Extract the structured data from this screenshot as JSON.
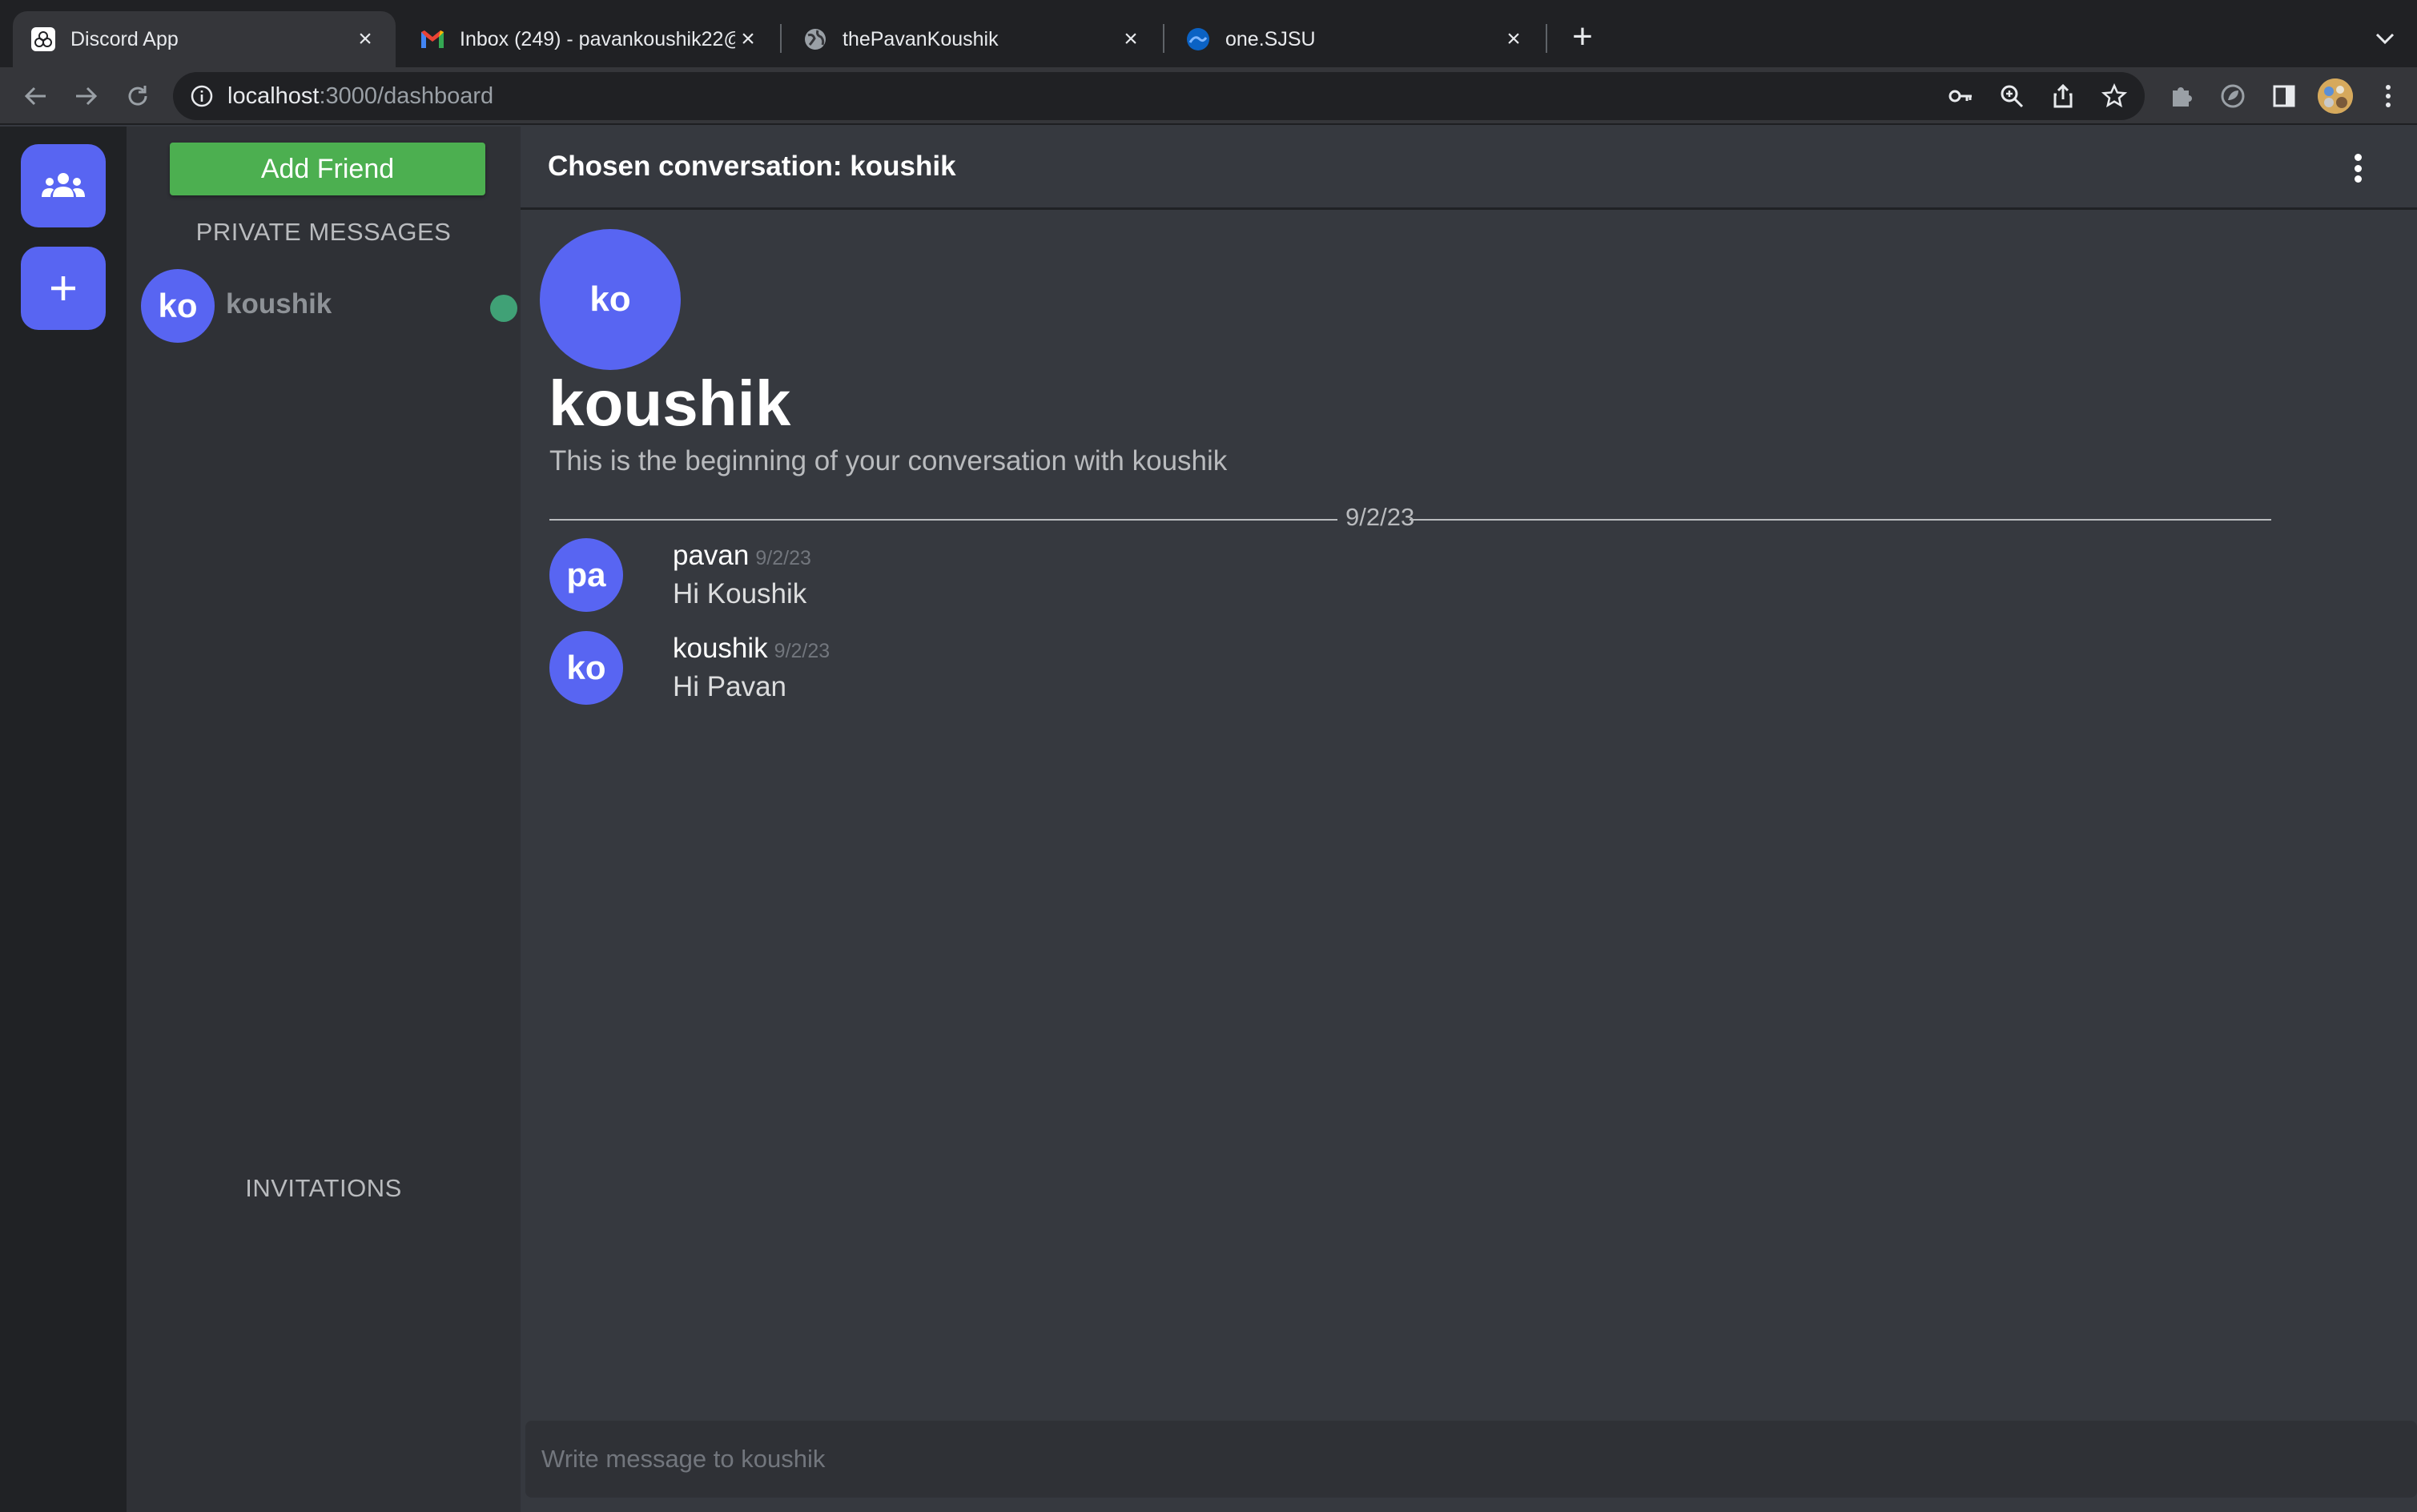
{
  "browser": {
    "tabs": [
      {
        "title": "Discord App",
        "active": true
      },
      {
        "title": "Inbox (249) - pavankoushik22@",
        "active": false
      },
      {
        "title": "thePavanKoushik",
        "active": false
      },
      {
        "title": "one.SJSU",
        "active": false
      }
    ],
    "address_host": "localhost",
    "address_path": ":3000/dashboard"
  },
  "sidebar": {
    "add_friend_label": "Add Friend",
    "private_messages_heading": "PRIVATE MESSAGES",
    "friends": [
      {
        "initials": "ko",
        "name": "koushik",
        "online": true
      }
    ],
    "invitations_heading": "INVITATIONS"
  },
  "chat": {
    "header_title": "Chosen conversation: koushik",
    "intro": {
      "initials": "ko",
      "name": "koushik",
      "subtitle": "This is the beginning of your conversation with koushik"
    },
    "date_divider": "9/2/23",
    "messages": [
      {
        "initials": "pa",
        "author": "pavan",
        "date": "9/2/23",
        "text": "Hi Koushik"
      },
      {
        "initials": "ko",
        "author": "koushik",
        "date": "9/2/23",
        "text": "Hi Pavan"
      }
    ],
    "composer_placeholder": "Write message to koushik"
  },
  "colors": {
    "accent": "#5865f2",
    "add_friend": "#4caf50",
    "online": "#43b581"
  }
}
